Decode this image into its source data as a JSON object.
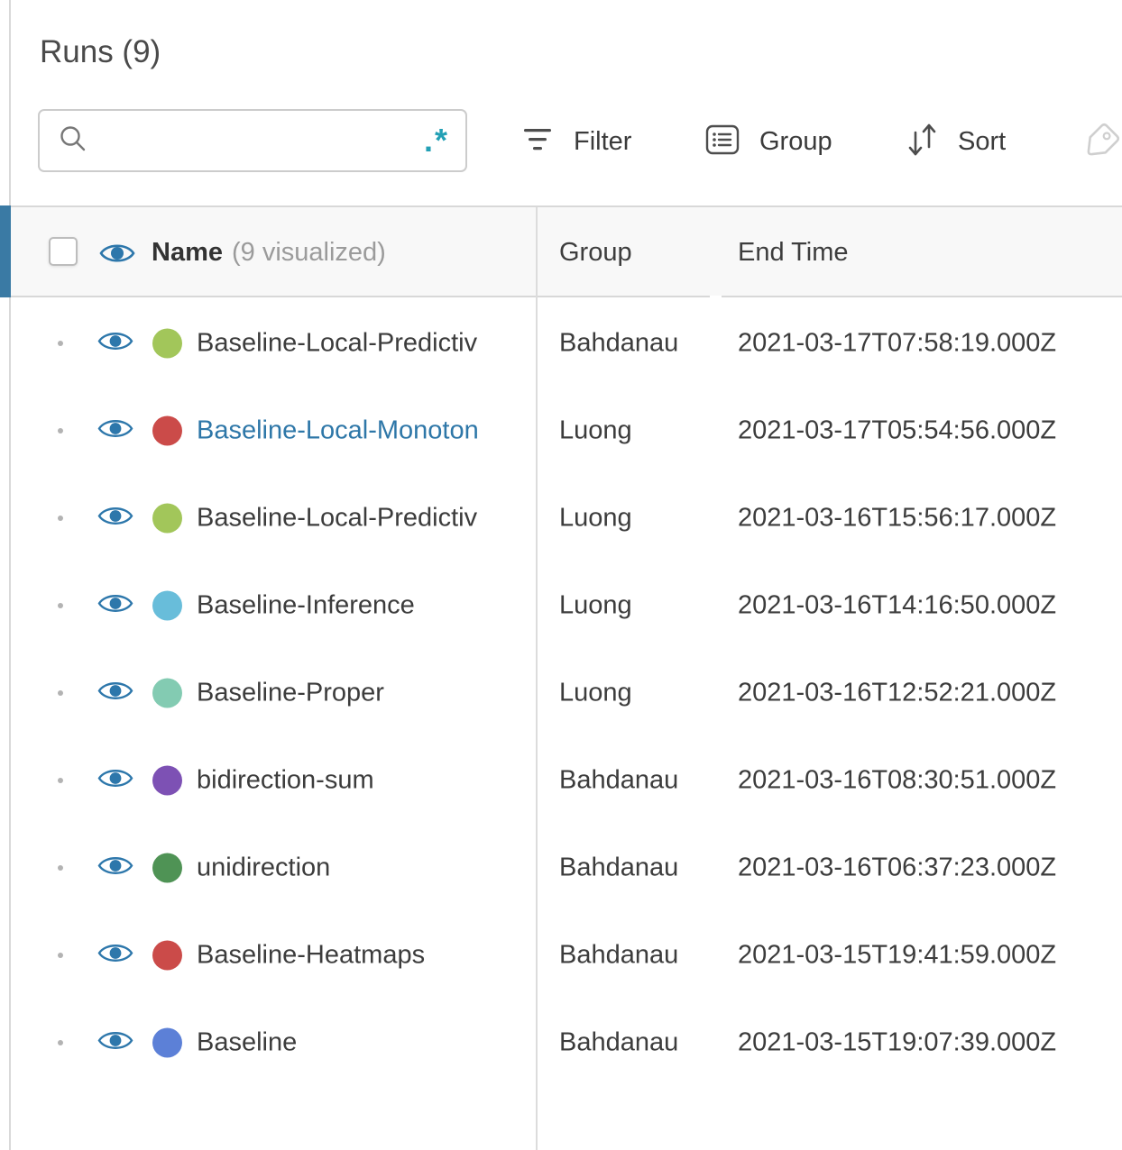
{
  "panel": {
    "title": "Runs (9)"
  },
  "search": {
    "value": "",
    "placeholder": "",
    "regex_toggle": ".*"
  },
  "toolbar": {
    "filter_label": "Filter",
    "group_label": "Group",
    "sort_label": "Sort"
  },
  "table": {
    "header": {
      "name": "Name",
      "visualized": "(9 visualized)",
      "group": "Group",
      "end_time": "End Time"
    },
    "rows": [
      {
        "name": "Baseline-Local-Predictiv",
        "color": "#a2c65a",
        "group": "Bahdanau",
        "end_time": "2021-03-17T07:58:19.000Z",
        "selected": false
      },
      {
        "name": "Baseline-Local-Monoton",
        "color": "#cb4b49",
        "group": "Luong",
        "end_time": "2021-03-17T05:54:56.000Z",
        "selected": true
      },
      {
        "name": "Baseline-Local-Predictiv",
        "color": "#a2c65a",
        "group": "Luong",
        "end_time": "2021-03-16T15:56:17.000Z",
        "selected": false
      },
      {
        "name": "Baseline-Inference",
        "color": "#68bdda",
        "group": "Luong",
        "end_time": "2021-03-16T14:16:50.000Z",
        "selected": false
      },
      {
        "name": "Baseline-Proper",
        "color": "#83cbb2",
        "group": "Luong",
        "end_time": "2021-03-16T12:52:21.000Z",
        "selected": false
      },
      {
        "name": "bidirection-sum",
        "color": "#7d51b4",
        "group": "Bahdanau",
        "end_time": "2021-03-16T08:30:51.000Z",
        "selected": false
      },
      {
        "name": "unidirection",
        "color": "#4f9355",
        "group": "Bahdanau",
        "end_time": "2021-03-16T06:37:23.000Z",
        "selected": false
      },
      {
        "name": "Baseline-Heatmaps",
        "color": "#cb4b49",
        "group": "Bahdanau",
        "end_time": "2021-03-15T19:41:59.000Z",
        "selected": false
      },
      {
        "name": "Baseline",
        "color": "#5c80d7",
        "group": "Bahdanau",
        "end_time": "2021-03-15T19:07:39.000Z",
        "selected": false
      }
    ]
  },
  "icons": {
    "search": "magnifier-icon",
    "regex": "regex-icon",
    "filter": "filter-lines-icon",
    "group": "list-icon",
    "sort": "arrows-up-down-icon",
    "tag": "tag-icon",
    "visibility": "eye-icon"
  },
  "colors": {
    "accent_bar": "#3a7aa4",
    "eye": "#2d77ab",
    "link": "#2e77a8",
    "regex": "#23a0b5",
    "header_bg": "#f8f8f8",
    "divider": "#dcdcdc"
  }
}
